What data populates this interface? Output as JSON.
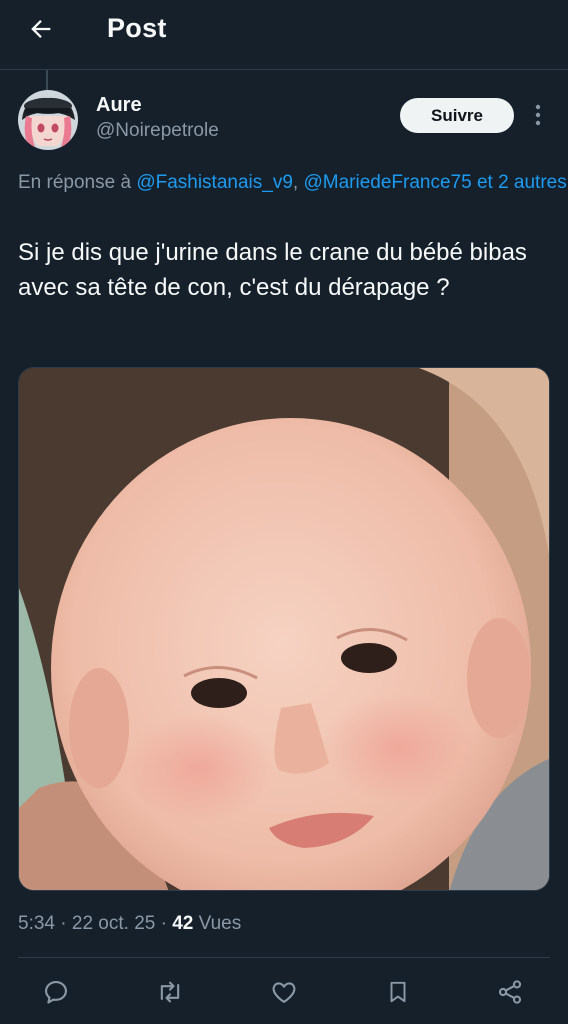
{
  "header": {
    "title": "Post",
    "back_icon": "arrow-left-icon"
  },
  "author": {
    "name": "Aure",
    "handle": "@Noirepetrole",
    "avatar_icon": "anime-avatar"
  },
  "follow_label": "Suivre",
  "more_icon": "more-vertical-icon",
  "reply_to": {
    "prefix": "En réponse à ",
    "mention1": "@Fashistanais_v9",
    "separator": ", ",
    "mention2": "@MariedeFrance75",
    "suffix": " et 2 autres"
  },
  "tweet": {
    "text": "Si je dis que j'urine dans le crane du bébé bibas avec sa tête de con, c'est du dérapage ?"
  },
  "media": {
    "kind": "photo",
    "subject": "baby-face-photo"
  },
  "meta": {
    "time": "5:34",
    "sep1": " · ",
    "date": "22 oct. 25",
    "sep2": " · ",
    "views_count": "42",
    "views_label": " Vues"
  },
  "actions": [
    "reply-icon",
    "retweet-icon",
    "like-icon",
    "bookmark-icon",
    "share-icon"
  ],
  "colors": {
    "background": "#15202b",
    "accent": "#1d9bf0",
    "secondary_text": "#8b98a5",
    "primary_text": "#f7f9f9"
  }
}
